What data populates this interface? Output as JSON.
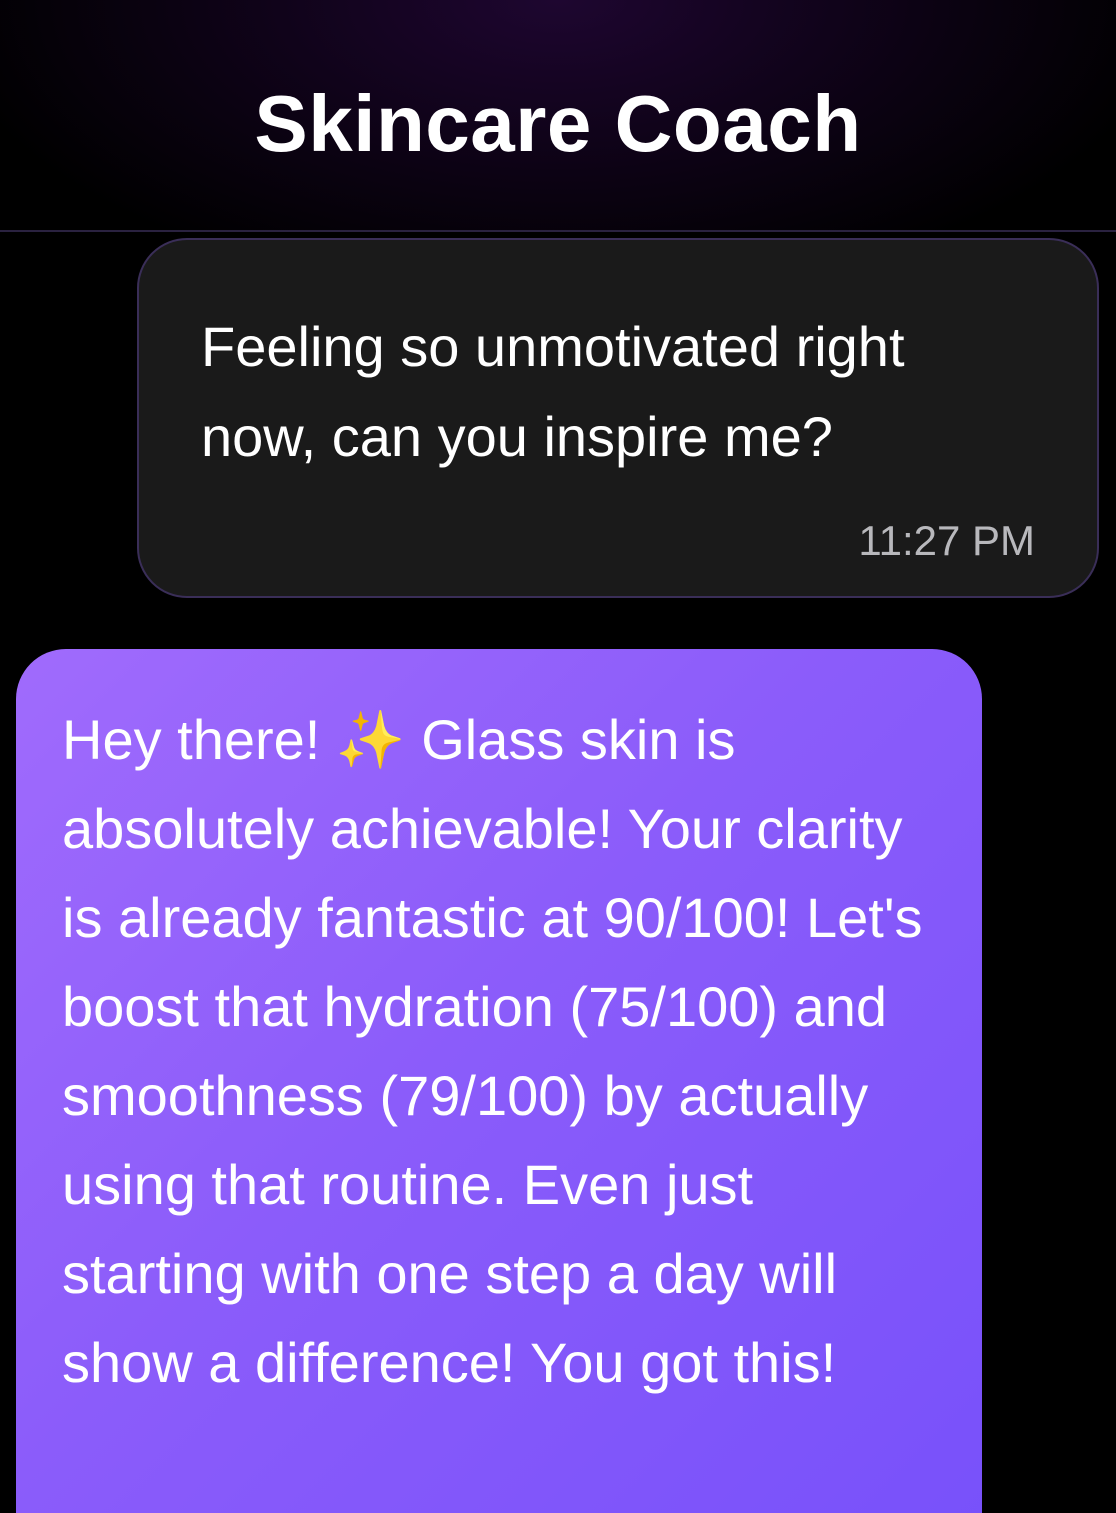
{
  "header": {
    "title": "Skincare Coach"
  },
  "messages": {
    "user": {
      "text": "Feeling so unmotivated right now, can you inspire me?",
      "time": "11:27 PM"
    },
    "coach": {
      "text_before_emoji": "Hey there! ",
      "emoji": "✨",
      "text_after_emoji": " Glass skin is absolutely achievable! Your clarity is already fantastic at 90/100! Let's boost that hydration (75/100) and smoothness (79/100) by actually using that routine. Even just starting with one step a day will show a difference! You got this!"
    }
  },
  "colors": {
    "background": "#000000",
    "user_bubble": "#1a1a1a",
    "user_bubble_border": "#3a2e58",
    "coach_bubble_start": "#a06bfc",
    "coach_bubble_end": "#7851fa",
    "timestamp": "#b8b8bc"
  }
}
